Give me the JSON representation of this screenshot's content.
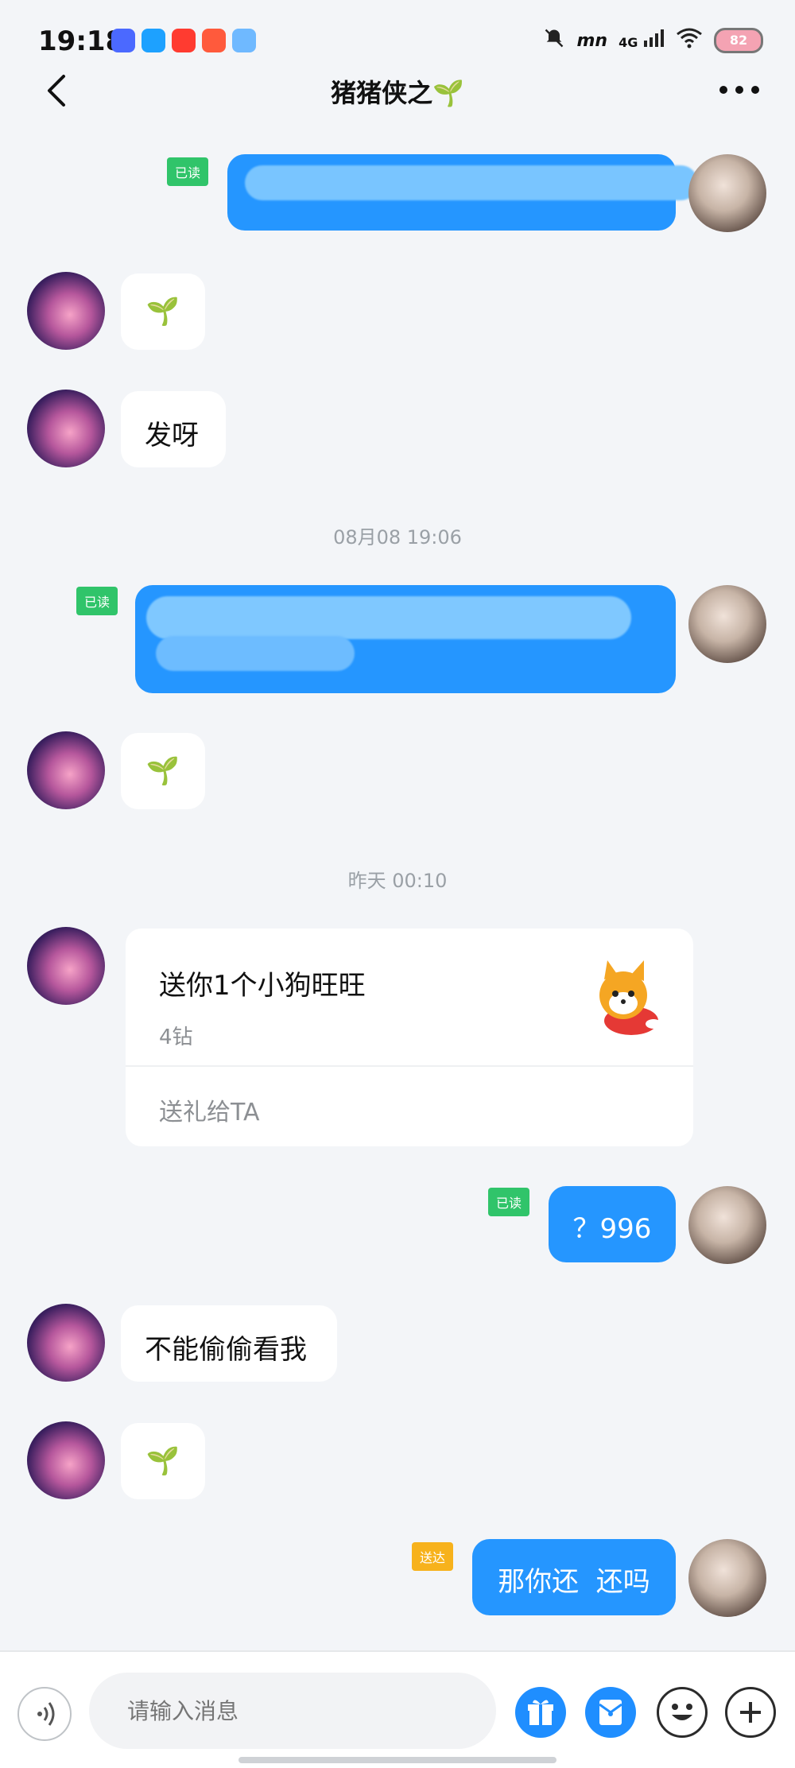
{
  "statusbar": {
    "time": "19:18",
    "network": "4G",
    "battery": "82"
  },
  "header": {
    "title": "猪猪侠之🌱"
  },
  "messages": {
    "read_label": "已读",
    "sending_label": "送达",
    "sprout": "🌱",
    "m3_text": "发呀",
    "ts1": "08月08 19:06",
    "ts2": "昨天 00:10",
    "gift_title": "送你1个小狗旺旺",
    "gift_price": "4钻",
    "gift_action": "送礼给TA",
    "m7_text": "？996",
    "m8_text": "不能偷偷看我",
    "m10_text": "那你还  还吗"
  },
  "input": {
    "placeholder": "请输入消息"
  },
  "colors": {
    "accent": "#2596ff",
    "read_badge": "#30c46a",
    "sending_badge": "#f7b21c",
    "background": "#f3f5f8"
  }
}
